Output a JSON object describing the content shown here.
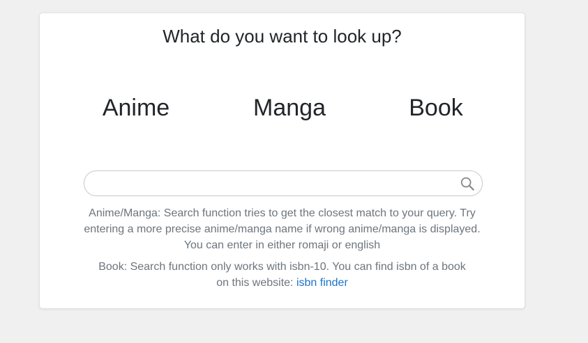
{
  "card": {
    "title": "What do you want to look up?"
  },
  "options": [
    {
      "label": "Anime"
    },
    {
      "label": "Manga"
    },
    {
      "label": "Book"
    }
  ],
  "search": {
    "value": "",
    "placeholder": ""
  },
  "help": {
    "anime_manga": "Anime/Manga: Search function tries to get the closest match to your query. Try entering a more precise anime/manga name if wrong anime/manga is displayed. You can enter in either romaji or english",
    "book_prefix": "Book: Search function only works with isbn-10. You can find isbn of a book on this website: ",
    "book_link": "isbn finder"
  },
  "colors": {
    "background": "#f0f0f0",
    "card": "#ffffff",
    "text": "#212529",
    "muted": "#6c757d",
    "link": "#1a73c8"
  },
  "icons": {
    "search": "search-icon"
  }
}
